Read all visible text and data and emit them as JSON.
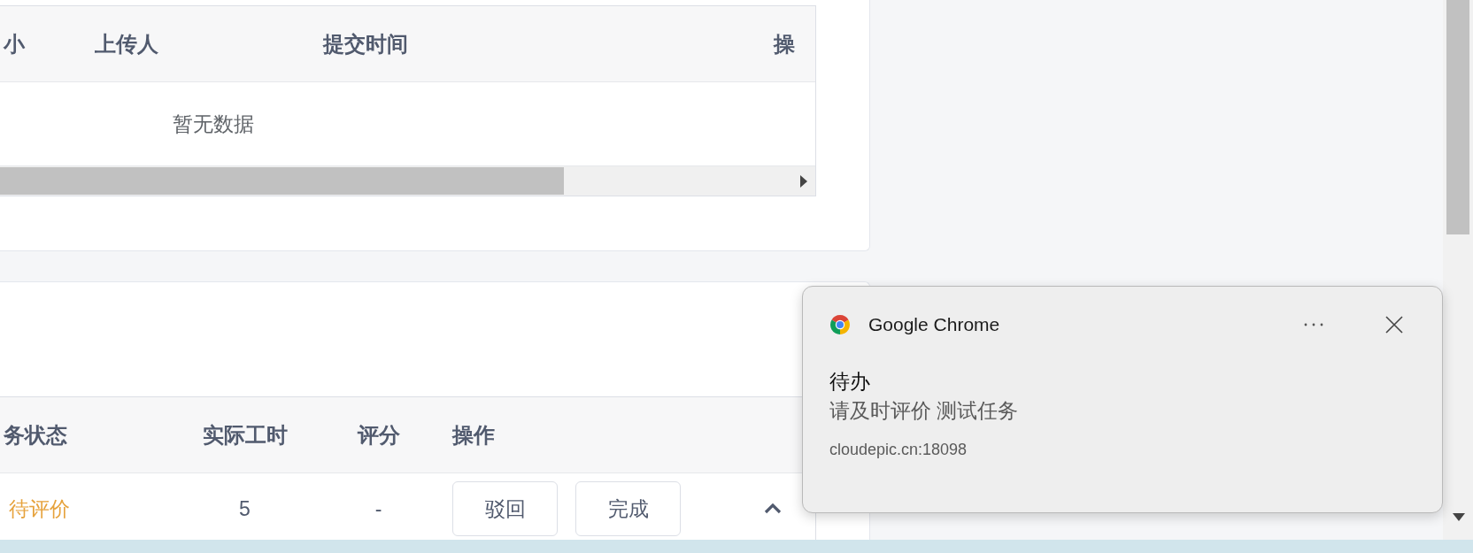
{
  "files_table": {
    "columns": [
      "小",
      "上传人",
      "提交时间",
      "操"
    ],
    "empty_text": "暂无数据"
  },
  "tasks_table": {
    "columns": [
      "务状态",
      "实际工时",
      "评分",
      "操作"
    ],
    "rows": [
      {
        "status": "待评价",
        "hours": "5",
        "score": "-",
        "actions": [
          "驳回",
          "完成"
        ],
        "expanded": true
      }
    ]
  },
  "notification": {
    "app": "Google Chrome",
    "title": "待办",
    "message": "请及时评价 测试任务",
    "source": "cloudepic.cn:18098"
  }
}
